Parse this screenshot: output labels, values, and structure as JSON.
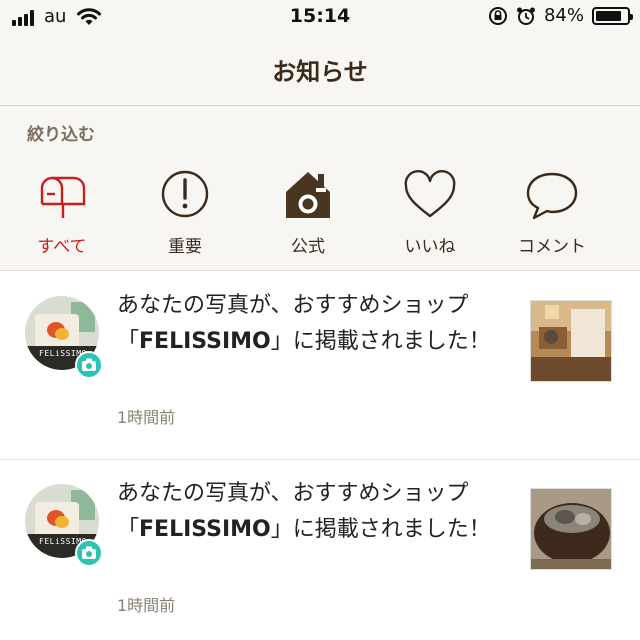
{
  "status_bar": {
    "carrier": "au",
    "time": "15:14",
    "battery_percent": "84%",
    "battery_level": 0.84,
    "icons": [
      "signal-icon",
      "wifi-icon",
      "rotation-lock-icon",
      "alarm-icon",
      "battery-icon"
    ]
  },
  "header": {
    "title": "お知らせ"
  },
  "filter": {
    "heading": "絞り込む",
    "tabs": [
      {
        "label": "すべて",
        "icon": "mailbox-icon",
        "active": true
      },
      {
        "label": "重要",
        "icon": "exclamation-icon",
        "active": false
      },
      {
        "label": "公式",
        "icon": "house-camera-icon",
        "active": false
      },
      {
        "label": "いいね",
        "icon": "heart-icon",
        "active": false
      },
      {
        "label": "コメント",
        "icon": "speech-bubble-icon",
        "active": false
      }
    ]
  },
  "notifications": [
    {
      "text_before": "あなたの写真が、おすすめショップ「",
      "brand": "FELISSIMO",
      "text_after": "」に掲載されました！",
      "time": "1時間前",
      "avatar_brand": "FELiSSIMO"
    },
    {
      "text_before": "あなたの写真が、おすすめショップ「",
      "brand": "FELISSIMO",
      "text_after": "」に掲載されました！",
      "time": "1時間前",
      "avatar_brand": "FELiSSIMO"
    }
  ],
  "colors": {
    "accent_red": "#c81e1e",
    "brown": "#3b2a1a",
    "badge_teal": "#2cc3b5",
    "background": "#f8f6f3"
  }
}
